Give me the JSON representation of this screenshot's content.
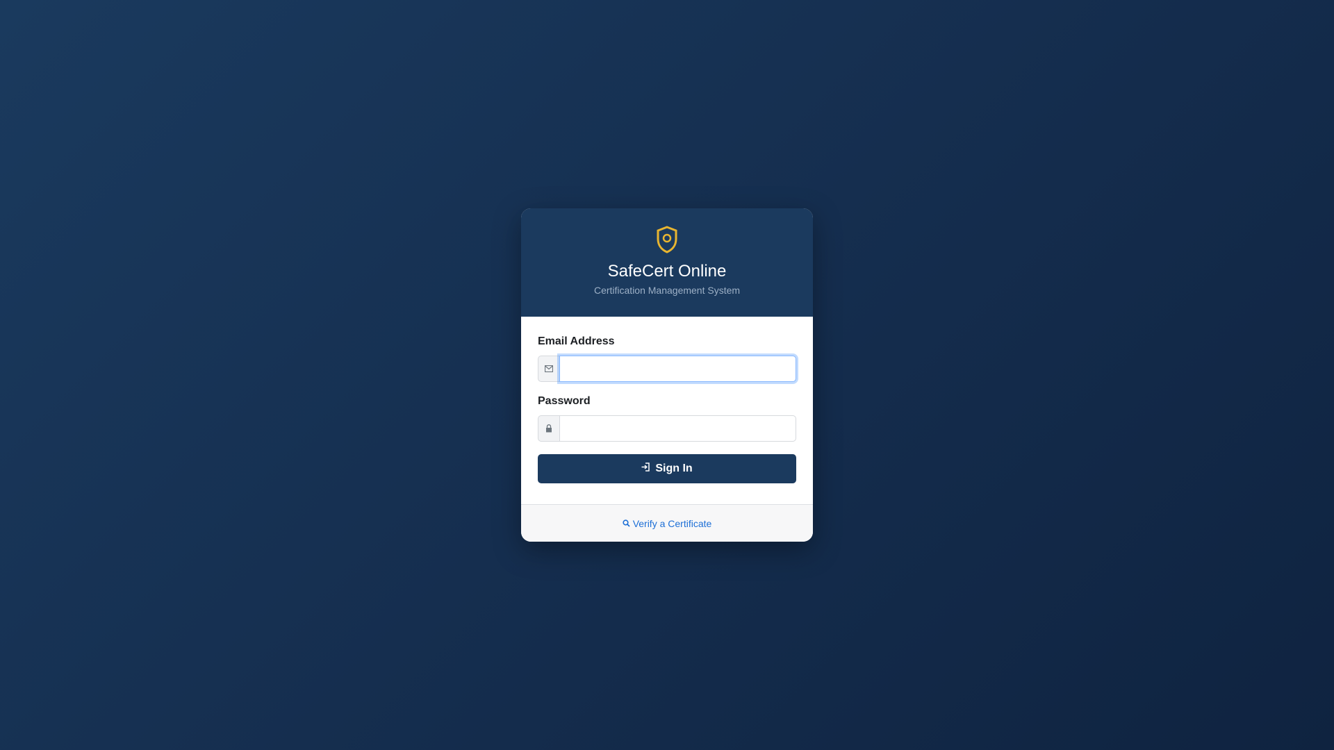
{
  "header": {
    "logo_icon": "certificate-icon",
    "logo_color": "#e8b530",
    "title": "SafeCert Online",
    "subtitle": "Certification Management System"
  },
  "form": {
    "email": {
      "label": "Email Address",
      "icon": "envelope-icon",
      "value": "",
      "placeholder": "",
      "focused": true
    },
    "password": {
      "label": "Password",
      "icon": "lock-icon",
      "value": "",
      "placeholder": ""
    },
    "signin": {
      "label": "Sign In",
      "icon": "sign-in-icon"
    }
  },
  "footer": {
    "verify_link": "Verify a Certificate",
    "verify_icon": "search-icon",
    "link_color": "#1d6fd6"
  },
  "colors": {
    "primary": "#1b3a5e",
    "background": "#163252"
  }
}
